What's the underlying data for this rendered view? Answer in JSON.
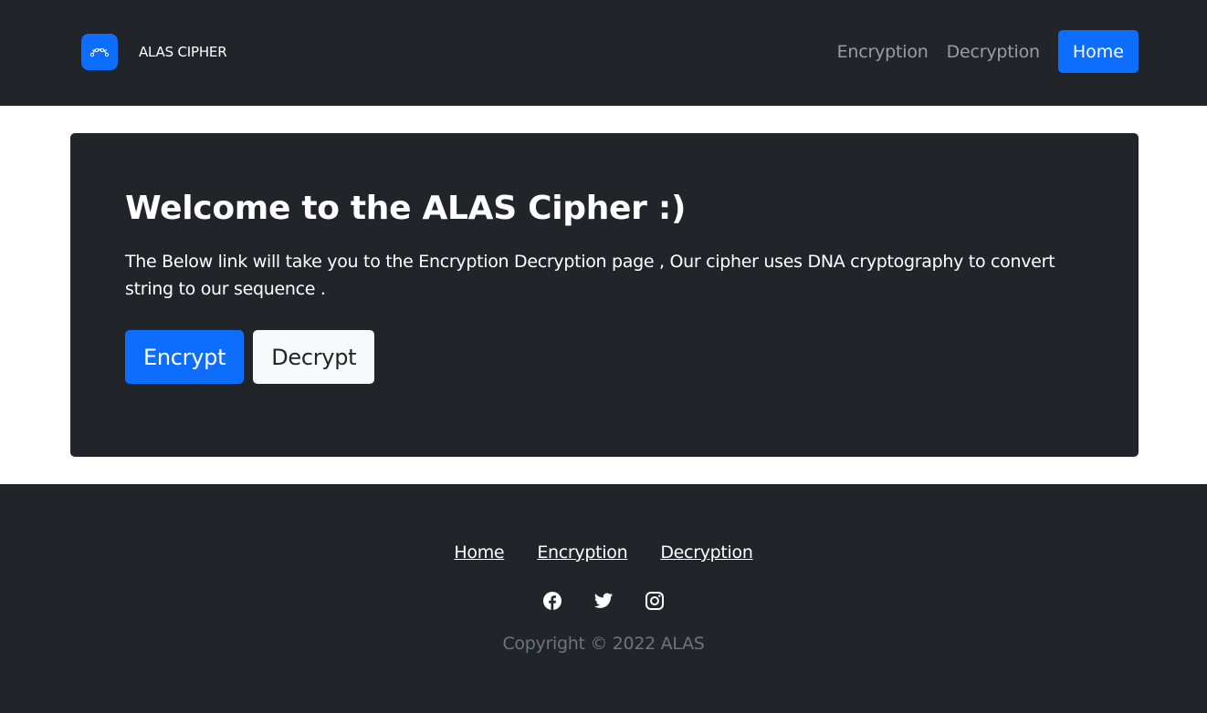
{
  "navbar": {
    "brand_icon": "bezier-curve-icon",
    "brand_text": "ALAS CIPHER",
    "links": [
      "Encryption",
      "Decryption"
    ],
    "home_button": "Home"
  },
  "hero": {
    "title": "Welcome to the ALAS Cipher :)",
    "description": "The Below link will take you to the Encryption Decryption page , Our cipher uses DNA cryptography to convert string to our sequence .",
    "primary_button": "Encrypt",
    "secondary_button": "Decrypt"
  },
  "footer": {
    "links": [
      "Home",
      "Encryption",
      "Decryption"
    ],
    "social_icons": [
      "facebook-icon",
      "twitter-icon",
      "instagram-icon"
    ],
    "copyright": "Copyright © 2022 ALAS"
  },
  "colors": {
    "dark": "#212529",
    "primary": "#0d6efd",
    "light": "#f8f9fa",
    "muted": "#6c757d"
  }
}
